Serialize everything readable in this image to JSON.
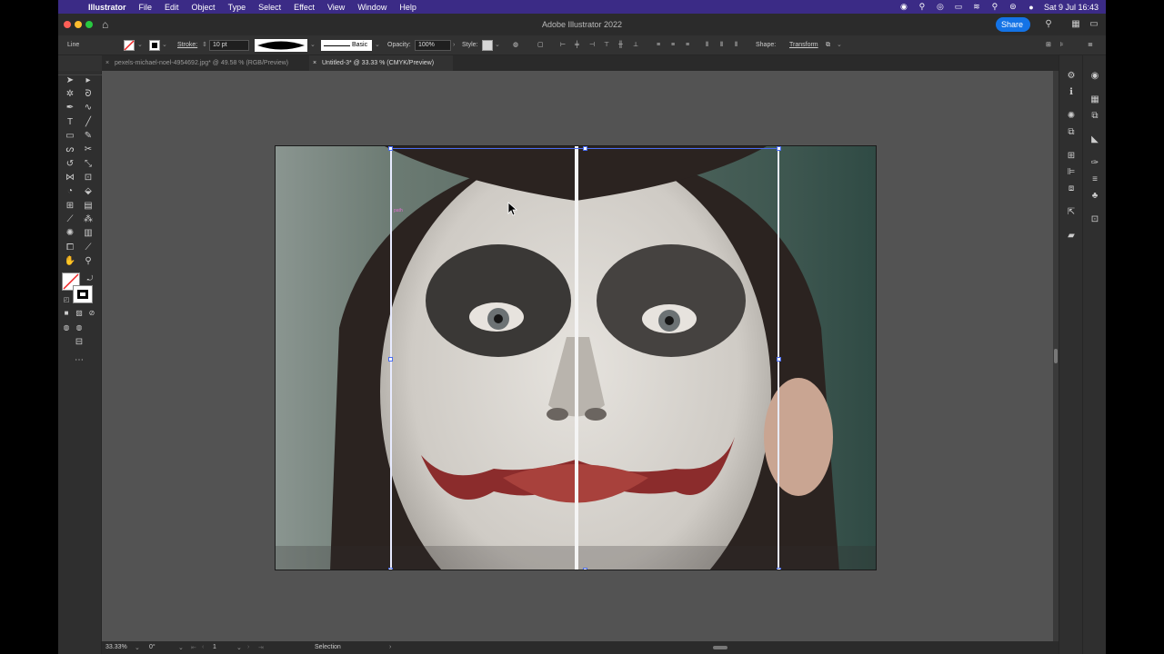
{
  "menubar": {
    "app_name": "Illustrator",
    "items": [
      "File",
      "Edit",
      "Object",
      "Type",
      "Select",
      "Effect",
      "View",
      "Window",
      "Help"
    ],
    "clock": "Sat 9 Jul  16:43"
  },
  "window": {
    "title": "Adobe Illustrator 2022",
    "share_label": "Share"
  },
  "control_bar": {
    "object_type": "Line",
    "stroke_label": "Stroke:",
    "stroke_weight": "10 pt",
    "brush_label": "Basic",
    "opacity_label": "Opacity:",
    "opacity_value": "100%",
    "style_label": "Style:",
    "shape_label": "Shape:",
    "transform_label": "Transform"
  },
  "tabs": [
    {
      "label": "pexels-michael-noel-4954692.jpg* @ 49.58 % (RGB/Preview)"
    },
    {
      "label": "Untitled-3* @ 33.33 % (CMYK/Preview)"
    }
  ],
  "canvas": {
    "path_label": "path"
  },
  "status_bar": {
    "zoom": "33.33%",
    "rotation": "0°",
    "artboard_number": "1",
    "tool_name": "Selection"
  },
  "colors": {
    "accent": "#1473e6",
    "menubar": "#3b2b86",
    "selection": "#4a6cf0"
  }
}
